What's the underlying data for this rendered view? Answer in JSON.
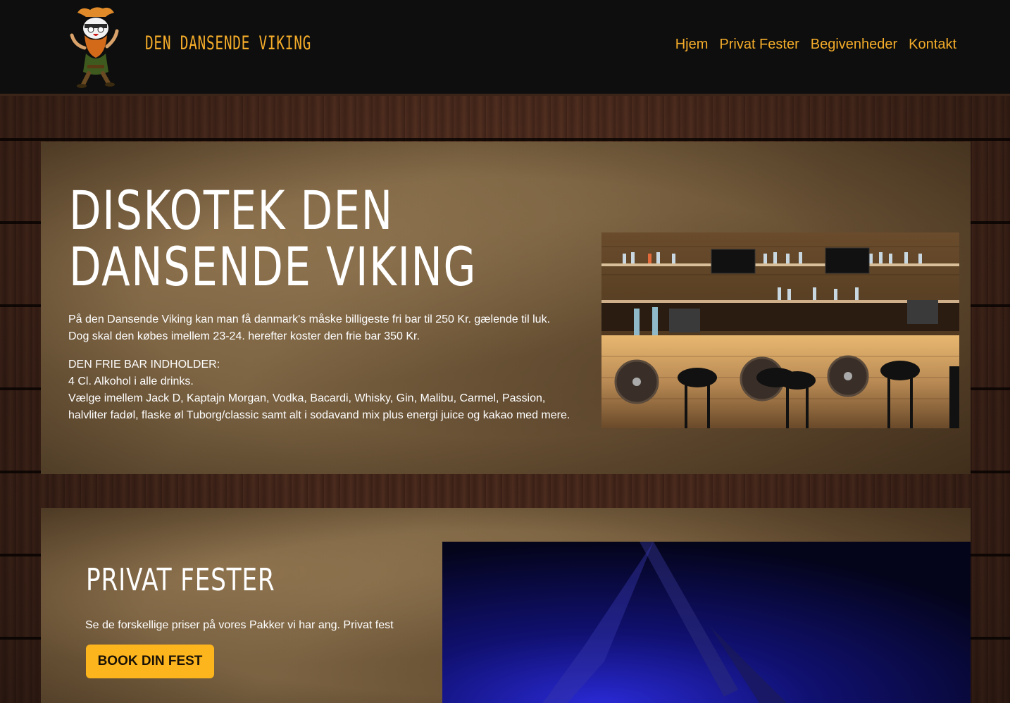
{
  "header": {
    "brand": "DEN DANSENDE VIKING",
    "logo_icon": "dancing-viking-mascot",
    "nav": [
      {
        "label": "Hjem"
      },
      {
        "label": "Privat Fester"
      },
      {
        "label": "Begivenheder"
      },
      {
        "label": "Kontakt"
      }
    ]
  },
  "hero": {
    "title": "Diskotek Den Dansende Viking",
    "intro_line1": "På den Dansende Viking kan man få danmark's måske billigeste fri bar til 250 Kr. gælende til luk.",
    "intro_line2": "Dog skal den købes imellem 23-24. herefter koster den frie bar 350 Kr.",
    "bar_heading": "DEN FRIE BAR INDHOLDER:",
    "bar_line1": "4 Cl. Alkohol i alle drinks.",
    "bar_line2": "Vælge imellem Jack D, Kaptajn Morgan, Vodka, Bacardi, Whisky, Gin, Malibu, Carmel, Passion,",
    "bar_line3": "halvliter fadøl, flaske øl Tuborg/classic samt alt i sodavand mix plus energi juice og kakao med mere.",
    "image": "bar-interior-photo"
  },
  "private": {
    "title": "Privat Fester",
    "text": "Se de forskellige priser på vores Pakker vi har ang. Privat fest",
    "button": "BOOK DIN FEST",
    "image": "dance-floor-photo"
  },
  "colors": {
    "accent": "#f5ac2a",
    "button": "#fdb51d",
    "header_bg": "#0d0e0d"
  }
}
